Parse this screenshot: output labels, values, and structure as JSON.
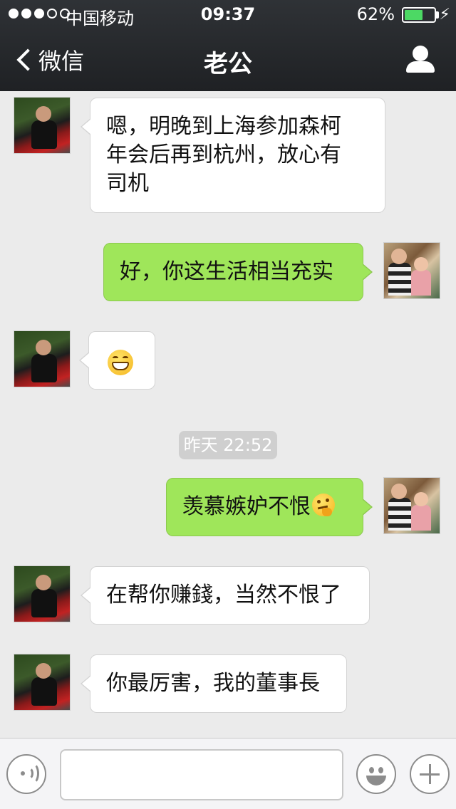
{
  "status_bar": {
    "signal_bars_filled": 3,
    "signal_bars_total": 5,
    "carrier": "中国移动",
    "time": "09:37",
    "battery_percent": "62%",
    "battery_level": 0.62,
    "charging_icon": "bolt-icon"
  },
  "nav": {
    "back_label": "微信",
    "title": "老公",
    "profile_icon": "person-icon"
  },
  "messages": [
    {
      "side": "left",
      "sender": "husband",
      "text": "嗯，明晚到上海参加森柯\n年会后再到杭州，放心有\n司机"
    },
    {
      "side": "right",
      "sender": "me",
      "text": "好，你这生活相当充实"
    },
    {
      "side": "left",
      "sender": "husband",
      "emoji": "grin-emoji"
    },
    {
      "side": "right",
      "sender": "me",
      "text": "羡慕嫉妒不恨",
      "emoji": "thinking-emoji"
    },
    {
      "side": "left",
      "sender": "husband",
      "text": "在帮你赚錢，当然不恨了"
    },
    {
      "side": "left",
      "sender": "husband",
      "text": "你最厉害，我的董事長"
    }
  ],
  "timestamp": "昨天 22:52",
  "input_bar": {
    "voice_icon": "voice-icon",
    "text_value": "",
    "emoji_icon": "emoji-icon",
    "plus_icon": "plus-icon"
  },
  "colors": {
    "nav_background": "#26292c",
    "chat_background": "#ebebeb",
    "my_bubble": "#9fe65a",
    "their_bubble": "#ffffff",
    "battery_fill": "#4cd964"
  }
}
